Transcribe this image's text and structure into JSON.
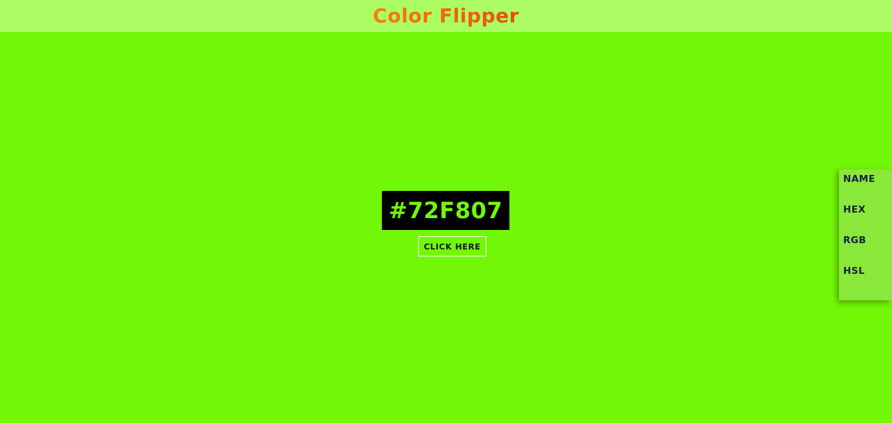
{
  "header": {
    "title": "Color Flipper"
  },
  "display": {
    "hex_value": "#72F807",
    "button_label": "CLICK HERE"
  },
  "side_menu": {
    "items": [
      {
        "label": "NAME"
      },
      {
        "label": "HEX"
      },
      {
        "label": "RGB"
      },
      {
        "label": "HSL"
      }
    ]
  },
  "colors": {
    "background": "#72F807",
    "header_background": "#abfd63",
    "title_gradient_start": "#f77f0c",
    "title_gradient_end": "#ee4a06",
    "hex_box_background": "#000000",
    "hex_text": "#72F807",
    "side_menu_background": "#8ae83a",
    "menu_text": "#14213d"
  }
}
